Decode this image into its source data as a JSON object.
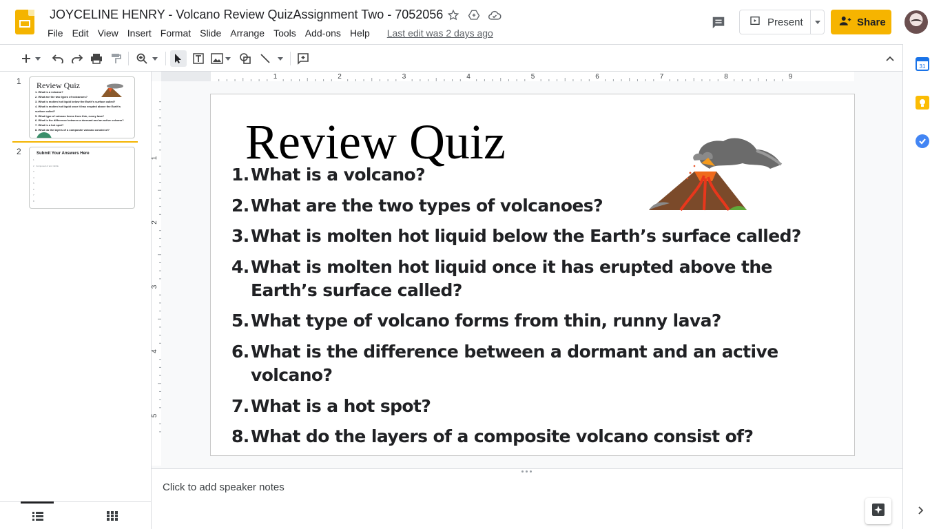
{
  "header": {
    "doc_title": "JOYCELINE HENRY - Volcano Review QuizAssignment Two - 7052056",
    "menu": [
      "File",
      "Edit",
      "View",
      "Insert",
      "Format",
      "Slide",
      "Arrange",
      "Tools",
      "Add-ons",
      "Help"
    ],
    "last_edit": "Last edit was 2 days ago",
    "present_label": "Present",
    "share_label": "Share"
  },
  "filmstrip": {
    "slides": [
      {
        "number": "1",
        "title": "Review Quiz",
        "lines": [
          "1. What is a volcano?",
          "2. What are the two types of volcanoes?",
          "3. What is molten hot liquid below the Earth's surface called?",
          "4. What is molten hot liquid once it has erupted above the Earth's surface called?",
          "5. What type of volcano forms from thin, runny lava?",
          "6. What is the difference between a dormant and an active volcano?",
          "7. What is a hot spot?",
          "8. What do the layers of a composite volcano consist of?"
        ]
      },
      {
        "number": "2",
        "title": "Submit Your Answers Here",
        "lines": [
          "1",
          "2",
          "3",
          "4",
          "5",
          "6",
          "7",
          "8"
        ],
        "answer_hint": "Composed of and rubble"
      }
    ]
  },
  "slide": {
    "title": "Review Quiz",
    "questions": [
      {
        "num": "1.",
        "text": "What is a volcano?"
      },
      {
        "num": "2.",
        "text": "What are the two types of volcanoes?"
      },
      {
        "num": "3.",
        "text": "What is molten hot liquid below the Earth’s surface called?"
      },
      {
        "num": "4.",
        "text": "What is molten hot liquid once it has erupted above the Earth’s surface called?"
      },
      {
        "num": "5.",
        "text": "What type of volcano forms from thin, runny lava?"
      },
      {
        "num": "6.",
        "text": "What is the difference between a dormant and an active volcano?"
      },
      {
        "num": "7.",
        "text": "What is a hot spot?"
      },
      {
        "num": "8.",
        "text": "What do the layers of a composite volcano consist of?"
      }
    ]
  },
  "ruler": {
    "h_labels": [
      "1",
      "2",
      "3",
      "4",
      "5",
      "6",
      "7",
      "8",
      "9"
    ],
    "v_labels": [
      "1",
      "2",
      "3",
      "4",
      "5"
    ]
  },
  "notes": {
    "placeholder": "Click to add speaker notes"
  },
  "colors": {
    "accent": "#f4b400",
    "share": "#f6b400",
    "calendar": "#1a73e8",
    "keep": "#fbbc04",
    "tasks": "#4285f4"
  }
}
